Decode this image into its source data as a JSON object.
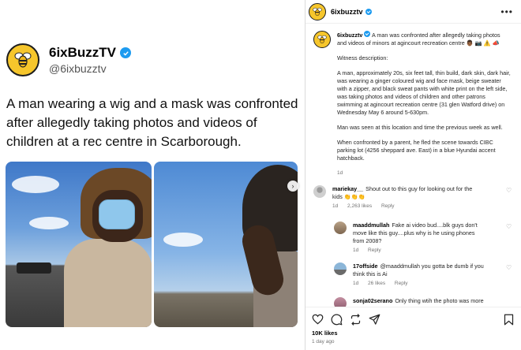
{
  "tweet": {
    "display_name": "6ixBuzzTV",
    "handle": "@6ixbuzztv",
    "text": "A man wearing a wig and a mask was confronted after allegedly taking photos and videos of children at a rec centre in Scarborough."
  },
  "post": {
    "username": "6ixbuzztv",
    "more_label": "•••",
    "caption_lead": "A man was confronted after allegedly taking photos and videos of minors at agincourt recreation centre 👨🏾 📷 ⚠️ 📣",
    "caption_paragraphs": [
      "Witness description:",
      "A man, approximately 20s, six feet tall, thin build, dark skin, dark hair, was wearing a ginger coloured wig and face mask, beige sweater with a zipper, and black sweat pants with white print on the left side, was taking photos and videos of children and other patrons swimming at agincourt recreation centre (31 glen Watford drive) on Wednesday May 6 around 5-630pm.",
      "Man was seen at this location and time the previous week as well.",
      "When confronted by a parent, he fled the scene towards CIBC parking lot (4256 sheppard ave. East) in a blue Hyundai accent hatchback."
    ],
    "caption_age": "1d",
    "likes": "10K likes",
    "time_ago": "1 day ago"
  },
  "comments": [
    {
      "username": "mariekay__",
      "text": "Shout out to this guy for looking out for the kids 👏👏👏",
      "age": "1d",
      "likes": "2,263 likes",
      "reply_label": "Reply"
    },
    {
      "username": "maaddmullah",
      "text": "Fake ai video bud....blk guys don't move like this guy....plus why is he using phones from 2008?",
      "age": "1d",
      "likes": "",
      "reply_label": "Reply"
    },
    {
      "username": "17offside",
      "text": "@maaddmullah you gotta be dumb if you think this is Ai",
      "age": "1d",
      "likes": "26 likes",
      "reply_label": "Reply"
    },
    {
      "username": "sonja02serano",
      "text": "Only thing wtih the photo was more",
      "age": "",
      "likes": "",
      "reply_label": ""
    }
  ],
  "icons": {
    "heart": "heart-icon",
    "comment": "comment-icon",
    "share": "share-icon",
    "repost": "repost-icon",
    "save": "bookmark-icon",
    "verified": "verified-badge-icon",
    "next": "chevron-right-icon"
  },
  "colors": {
    "verified": "#1d9bf0",
    "avatar_bg": "#f6c62c"
  }
}
